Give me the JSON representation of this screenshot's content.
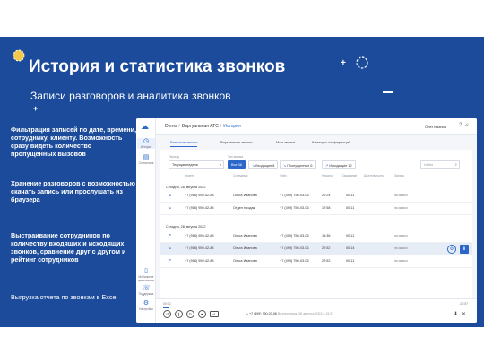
{
  "slide": {
    "title": "История и статистика звонков",
    "subtitle": "Записи разговоров и аналитика звонков",
    "features": [
      "Фильтрация записей по дате, времени, сотруднику, клиенту. Возможность сразу видеть количество пропущенных вызовов",
      "Хранение разговоров с возможностью скачать запись или прослушать из браузера",
      "Выстраивание сотрудников по количеству входящих и исходящих звонков, сравнение друг с другом и рейтинг сотрудников",
      "Выгрузка отчета по звонкам в Excel"
    ],
    "colors": {
      "background": "#1b4b9a",
      "accent": "#2a67c9",
      "text": "#ffffff"
    }
  },
  "app": {
    "sidebar": [
      {
        "label": "История",
        "icon": "history-icon"
      },
      {
        "label": "Статистика",
        "icon": "chart-icon"
      },
      {
        "label": "Мобильное приложение",
        "icon": "phone-icon"
      },
      {
        "label": "Поддержка",
        "icon": "support-icon"
      },
      {
        "label": "Настройки",
        "icon": "gear-icon"
      }
    ],
    "breadcrumb": {
      "root": "Demo",
      "section": "Виртуальная АТС",
      "current": "История"
    },
    "user": "Олег Иванов",
    "tabs": [
      "Внешние звонки",
      "Внутренние звонки",
      "Мои звонки",
      "Команды конференций"
    ],
    "filters": {
      "period_label": "Период",
      "period_value": "Текущая неделя",
      "type_label": "Тип звонка",
      "chips": [
        {
          "label": "Все",
          "count": "36"
        },
        {
          "label": "Входящие",
          "count": "8"
        },
        {
          "label": "Пропущенные",
          "count": "6"
        },
        {
          "label": "Исходящие",
          "count": "12"
        }
      ],
      "search_placeholder": "Найти"
    },
    "columns": [
      "Клиент",
      "Сотрудник",
      "Чейз",
      "Начало",
      "Ожидание",
      "Длительность",
      "Запись"
    ],
    "groups": [
      {
        "date": "Сегодня, 28 августа 2022",
        "rows": [
          {
            "client": "+7 (916) 959-42-84",
            "employee": "Ольга Иванова",
            "line": "+7 (499) 750-03-06",
            "start": "22:24",
            "wait": "00:11",
            "record": "на записи"
          },
          {
            "client": "+7 (916) 959-42-84",
            "employee": "Отдел продаж",
            "line": "+7 (499) 750-03-06",
            "start": "17:58",
            "wait": "00:11",
            "record": "на записи"
          }
        ]
      },
      {
        "date": "Сегодня, 28 августа 2022",
        "rows": [
          {
            "client": "+7 (916) 959-42-84",
            "employee": "Ольга Иванова",
            "line": "+7 (499) 750-03-06",
            "start": "15:36",
            "wait": "00:11",
            "record": "на записи"
          },
          {
            "client": "+7 (916) 959-42-84",
            "employee": "Ольга Иванова",
            "line": "+7 (499) 750-03-06",
            "start": "22:52",
            "wait": "00:14",
            "record": "на записи"
          },
          {
            "client": "+7 (916) 959-42-84",
            "employee": "Ольга Иванова",
            "line": "+7 (499) 750-03-06",
            "start": "22:52",
            "wait": "00:11",
            "record": "на записи"
          }
        ]
      }
    ],
    "player": {
      "time_current": "00:00",
      "time_total": "-00:57",
      "progress": 0.02,
      "speed": "x1",
      "info_line": "+7 (499) 750-03-06",
      "info_detail": "Вознесенска, 28 августа 2022 в 15:37"
    }
  }
}
